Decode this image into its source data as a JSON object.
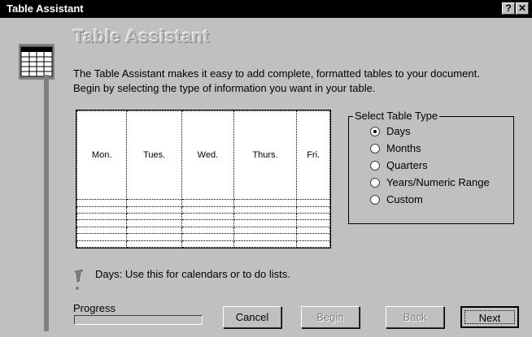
{
  "window": {
    "title": "Table Assistant",
    "help_glyph": "?",
    "close_glyph": "✕"
  },
  "header": {
    "heading": "Table Assistant",
    "icon": "table-icon"
  },
  "description": {
    "line1": "The Table Assistant makes it easy to add complete, formatted tables to your document.",
    "line2": "Begin by selecting the type of information you want in your table."
  },
  "preview": {
    "columns": [
      "Mon.",
      "Tues.",
      "Wed.",
      "Thurs.",
      "Fri."
    ],
    "empty_rows": 7
  },
  "table_type": {
    "title": "Select Table Type",
    "selected": "Days",
    "options": [
      {
        "label": "Days",
        "selected": true
      },
      {
        "label": "Months",
        "selected": false
      },
      {
        "label": "Quarters",
        "selected": false
      },
      {
        "label": "Years/Numeric Range",
        "selected": false
      },
      {
        "label": "Custom",
        "selected": false
      }
    ]
  },
  "hint": {
    "icon": "tip-icon",
    "text": "Days: Use this for calendars or to do lists."
  },
  "progress": {
    "label": "Progress",
    "value_percent": 0
  },
  "buttons": {
    "cancel": "Cancel",
    "begin": "Begin",
    "back": "Back",
    "next": "Next"
  },
  "colors": {
    "dialog_face": "#c0c0c0",
    "title_bar": "#000000",
    "disabled_text": "#808080"
  }
}
